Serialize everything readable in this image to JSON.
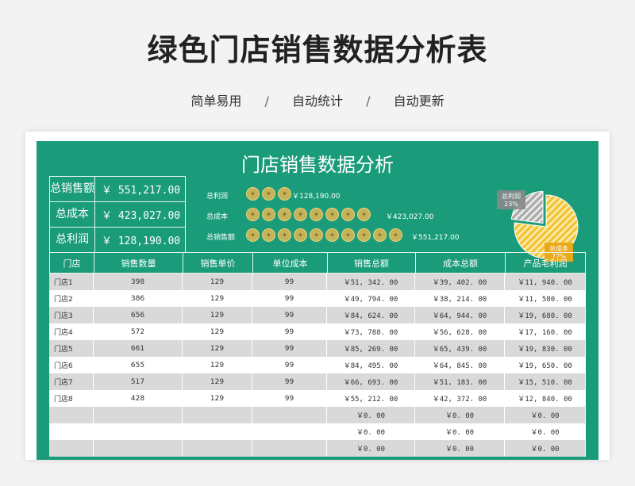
{
  "hero": {
    "title": "绿色门店销售数据分析表",
    "features": [
      "简单易用",
      "自动统计",
      "自动更新"
    ],
    "separator": "/"
  },
  "sheet": {
    "title": "门店销售数据分析",
    "kpis": [
      {
        "label": "总销售额",
        "value": "￥ 551,217.00"
      },
      {
        "label": "总成本",
        "value": "￥ 423,027.00"
      },
      {
        "label": "总利润",
        "value": "￥ 128,190.00"
      }
    ],
    "icon_rows": [
      {
        "label": "总利润",
        "coins": 3,
        "value": "￥128,190.00"
      },
      {
        "label": "总成本",
        "coins": 8,
        "value": "￥423,027.00"
      },
      {
        "label": "总销售额",
        "coins": 10,
        "value": "￥551,217.00"
      }
    ],
    "pie": {
      "slices": [
        {
          "label": "总利润",
          "percent": "23%",
          "value": 23,
          "color": "#a9a9a9"
        },
        {
          "label": "总成本",
          "percent": "77%",
          "value": 77,
          "color": "#f2c12e"
        }
      ]
    },
    "table": {
      "headers": [
        "门店",
        "销售数量",
        "销售单价",
        "单位成本",
        "销售总额",
        "成本总额",
        "产品毛利润"
      ],
      "rows": [
        [
          "门店1",
          "398",
          "129",
          "99",
          "￥51, 342. 00",
          "￥39, 402. 00",
          "￥11, 940. 00"
        ],
        [
          "门店2",
          "386",
          "129",
          "99",
          "￥49, 794. 00",
          "￥38, 214. 00",
          "￥11, 580. 00"
        ],
        [
          "门店3",
          "656",
          "129",
          "99",
          "￥84, 624. 00",
          "￥64, 944. 00",
          "￥19, 680. 00"
        ],
        [
          "门店4",
          "572",
          "129",
          "99",
          "￥73, 788. 00",
          "￥56, 628. 00",
          "￥17, 160. 00"
        ],
        [
          "门店5",
          "661",
          "129",
          "99",
          "￥85, 269. 00",
          "￥65, 439. 00",
          "￥19, 830. 00"
        ],
        [
          "门店6",
          "655",
          "129",
          "99",
          "￥84, 495. 00",
          "￥64, 845. 00",
          "￥19, 650. 00"
        ],
        [
          "门店7",
          "517",
          "129",
          "99",
          "￥66, 693. 00",
          "￥51, 183. 00",
          "￥15, 510. 00"
        ],
        [
          "门店8",
          "428",
          "129",
          "99",
          "￥55, 212. 00",
          "￥42, 372. 00",
          "￥12, 840. 00"
        ],
        [
          "",
          "",
          "",
          "",
          "￥0. 00",
          "￥0. 00",
          "￥0. 00"
        ],
        [
          "",
          "",
          "",
          "",
          "￥0. 00",
          "￥0. 00",
          "￥0. 00"
        ],
        [
          "",
          "",
          "",
          "",
          "￥0. 00",
          "￥0. 00",
          "￥0. 00"
        ]
      ]
    }
  }
}
